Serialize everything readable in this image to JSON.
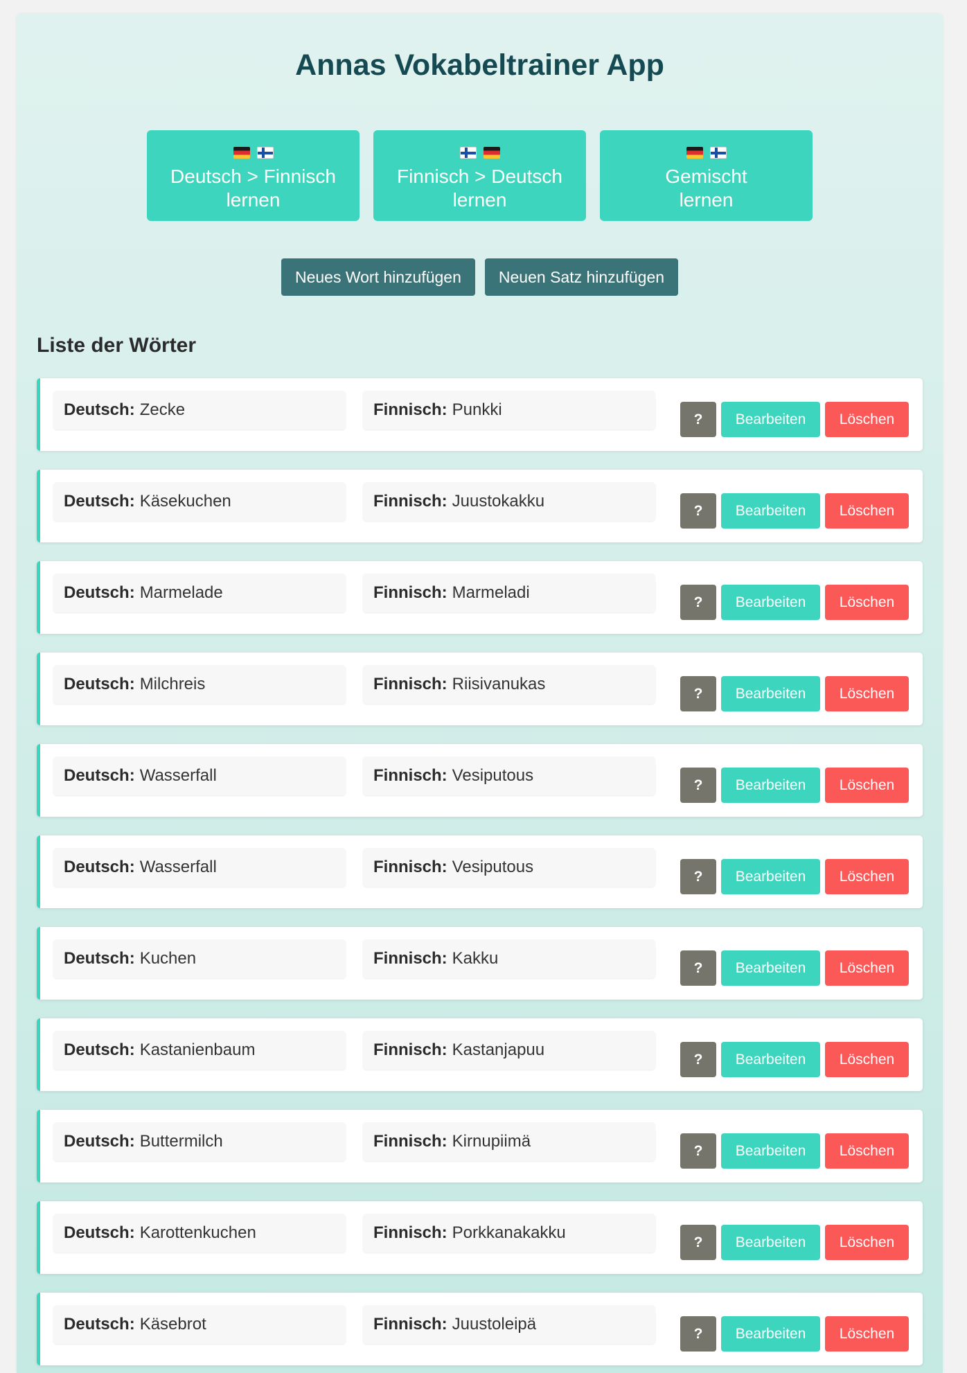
{
  "app": {
    "title": "Annas Vokabeltrainer App"
  },
  "learn_modes": [
    {
      "flags": [
        "de",
        "fi"
      ],
      "label": "Deutsch > Finnisch lernen"
    },
    {
      "flags": [
        "fi",
        "de"
      ],
      "label": "Finnisch > Deutsch lernen"
    },
    {
      "flags": [
        "de",
        "fi"
      ],
      "label": "Gemischt lernen"
    }
  ],
  "add_actions": {
    "add_word": "Neues Wort hinzufügen",
    "add_sentence": "Neuen Satz hinzufügen"
  },
  "list": {
    "title": "Liste der Wörter",
    "german_label": "Deutsch:",
    "finnish_label": "Finnisch:",
    "help_label": "?",
    "edit_label": "Bearbeiten",
    "delete_label": "Löschen",
    "items": [
      {
        "german": "Zecke",
        "finnish": "Punkki"
      },
      {
        "german": "Käsekuchen",
        "finnish": "Juustokakku"
      },
      {
        "german": "Marmelade",
        "finnish": "Marmeladi"
      },
      {
        "german": "Milchreis",
        "finnish": "Riisivanukas"
      },
      {
        "german": "Wasserfall",
        "finnish": "Vesiputous"
      },
      {
        "german": "Wasserfall",
        "finnish": "Vesiputous"
      },
      {
        "german": "Kuchen",
        "finnish": "Kakku"
      },
      {
        "german": "Kastanienbaum",
        "finnish": "Kastanjapuu"
      },
      {
        "german": "Buttermilch",
        "finnish": "Kirnupiimä"
      },
      {
        "german": "Karottenkuchen",
        "finnish": "Porkkanakakku"
      },
      {
        "german": "Käsebrot",
        "finnish": "Juustoleipä"
      }
    ]
  },
  "colors": {
    "accent": "#3dd5bd",
    "secondary": "#3a7479",
    "danger": "#fb5858",
    "help": "#75756b",
    "title": "#164a52"
  }
}
